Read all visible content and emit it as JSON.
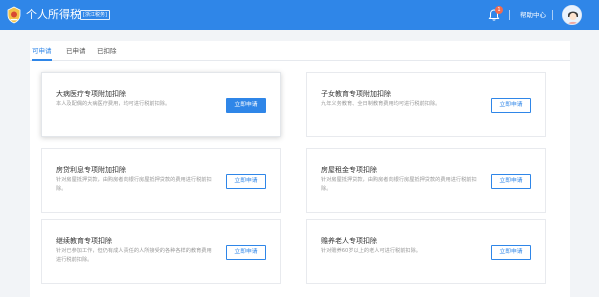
{
  "header": {
    "app_title": "个人所得税",
    "region": "[浙江税务]",
    "notification_count": "1",
    "help_label": "帮助中心",
    "colors": {
      "brand": "#2f86e8",
      "badge": "#f26b4e"
    },
    "icons": {
      "logo": "tax-emblem-icon",
      "bell": "bell-icon",
      "avatar": "user-avatar"
    }
  },
  "tabs": [
    {
      "label": "可申请",
      "active": true
    },
    {
      "label": "已申请",
      "active": false
    },
    {
      "label": "已扣除",
      "active": false
    }
  ],
  "cards": [
    {
      "title": "大病医疗专项附加扣除",
      "description": "本人及配偶的大病医疗费用，均可进行税前扣除。",
      "button": "立即申请",
      "highlighted": true
    },
    {
      "title": "子女教育专项附加扣除",
      "description": "九年义务教育、全日制教育费用均可进行税前扣除。",
      "button": "立即申请",
      "highlighted": false
    },
    {
      "title": "房贷利息专项附加扣除",
      "description": "针对房屋抵押贷款，由购房者向银行房屋抵押贷款的费用进行税前扣除。",
      "button": "立即申请",
      "highlighted": false
    },
    {
      "title": "房屋租金专项扣除",
      "description": "针对房屋抵押贷款，由购房者向银行房屋抵押贷款的费用进行税前扣除。",
      "button": "立即申请",
      "highlighted": false
    },
    {
      "title": "继续教育专项扣除",
      "description": "针对已参加工作，但仍有成人责任的人所接受的各种各样的教育费用进行税前扣除。",
      "button": "立即申请",
      "highlighted": false
    },
    {
      "title": "赡养老人专项扣除",
      "description": "针对赡养60岁以上的老人可进行税前扣除。",
      "button": "立即申请",
      "highlighted": false
    }
  ]
}
